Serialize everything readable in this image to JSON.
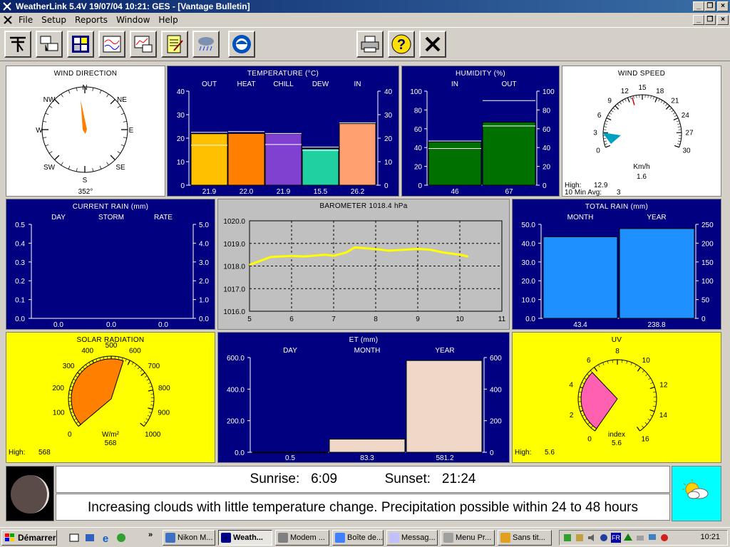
{
  "window": {
    "title": "WeatherLink 5.4V  19/07/04  10:21: GES - [Vantage Bulletin]"
  },
  "menu": [
    "File",
    "Setup",
    "Reports",
    "Window",
    "Help"
  ],
  "toolbar_icons": [
    "station-icon",
    "download-icon",
    "bulletin-icon",
    "strip-chart-icon",
    "graph-icon",
    "notes-icon",
    "rain-icon",
    "noaa-icon",
    "print-icon",
    "help-icon",
    "close-icon"
  ],
  "wind_direction": {
    "title": "WIND DIRECTION",
    "points": [
      "N",
      "NE",
      "E",
      "SE",
      "S",
      "SW",
      "W",
      "NW"
    ],
    "degrees": 352,
    "value": "352°"
  },
  "temperature": {
    "title": "TEMPERATURE (°C)",
    "ylim": [
      0,
      40
    ],
    "ticks": [
      "40",
      "30",
      "20",
      "10",
      "0"
    ],
    "bars": [
      {
        "label": "OUT",
        "value": 21.9,
        "hi": 22.5,
        "lo": 17.0,
        "color": "#ffc000",
        "text": "21.9"
      },
      {
        "label": "HEAT",
        "value": 22.0,
        "hi": 22.8,
        "lo": null,
        "color": "#ff8000",
        "text": "22.0"
      },
      {
        "label": "CHILL",
        "value": 21.9,
        "hi": 22.0,
        "lo": 17.3,
        "color": "#8040d0",
        "text": "21.9"
      },
      {
        "label": "DEW",
        "value": 15.5,
        "hi": 16.2,
        "lo": 14.8,
        "color": "#20d0a0",
        "text": "15.5"
      },
      {
        "label": "IN",
        "value": 26.2,
        "hi": 26.5,
        "lo": null,
        "color": "#ffa070",
        "text": "26.2"
      }
    ]
  },
  "humidity": {
    "title": "HUMIDITY (%)",
    "ticks": [
      "100",
      "80",
      "60",
      "40",
      "20",
      "0"
    ],
    "bars": [
      {
        "label": "IN",
        "value": 46,
        "hi": 47,
        "lo": 39,
        "text": "46"
      },
      {
        "label": "OUT",
        "value": 67,
        "hi": 90,
        "lo": 63,
        "text": "67"
      }
    ]
  },
  "wind_speed": {
    "title": "WIND SPEED",
    "ticks": [
      "0",
      "3",
      "6",
      "9",
      "12",
      "15",
      "18",
      "21",
      "24",
      "27",
      "30"
    ],
    "unit": "Km/h",
    "value": 1.6,
    "value_text": "1.6",
    "high_label": "High:",
    "high": "12.9",
    "avg_label": "10 Min Avg:",
    "avg": "3"
  },
  "current_rain": {
    "title": "CURRENT RAIN (mm)",
    "cols": [
      "DAY",
      "STORM",
      "RATE"
    ],
    "left_ticks": [
      "0.5",
      "0.4",
      "0.3",
      "0.2",
      "0.1",
      "0.0"
    ],
    "right_ticks": [
      "5.0",
      "4.0",
      "3.0",
      "2.0",
      "1.0",
      "0.0"
    ],
    "values": [
      "0.0",
      "0.0",
      "0.0"
    ]
  },
  "barometer": {
    "title": "BAROMETER 1018.4 hPa"
  },
  "total_rain": {
    "title": "TOTAL RAIN (mm)",
    "cols": [
      "MONTH",
      "YEAR"
    ],
    "left_ticks": [
      "50.0",
      "40.0",
      "30.0",
      "20.0",
      "10.0",
      "0.0"
    ],
    "right_ticks": [
      "250",
      "200",
      "150",
      "100",
      "50",
      "0"
    ],
    "values": [
      "43.4",
      "238.8"
    ]
  },
  "solar": {
    "title": "SOLAR RADIATION",
    "ticks": [
      "0",
      "100",
      "200",
      "300",
      "400",
      "500",
      "600",
      "700",
      "800",
      "900",
      "1000"
    ],
    "unit": "W/m²",
    "value": 568,
    "value_text": "568",
    "high_label": "High:",
    "high": "568"
  },
  "et": {
    "title": "ET (mm)",
    "cols": [
      "DAY",
      "MONTH",
      "YEAR"
    ],
    "left_ticks": [
      "600.0",
      "400.0",
      "200.0",
      "0.0"
    ],
    "right_ticks": [
      "600",
      "400",
      "200",
      "0"
    ],
    "values": [
      "0.5",
      "83.3",
      "581.2"
    ]
  },
  "uv": {
    "title": "UV",
    "ticks": [
      "0",
      "2",
      "4",
      "6",
      "8",
      "10",
      "12",
      "14",
      "16"
    ],
    "unit": "index",
    "value": 5.6,
    "value_text": "5.6",
    "high_label": "High:",
    "high": "5.6"
  },
  "sun": {
    "sunrise_label": "Sunrise:",
    "sunrise": "6:09",
    "sunset_label": "Sunset:",
    "sunset": "21:24"
  },
  "forecast": {
    "text": "Increasing clouds with little temperature change.  Precipitation possible within 24 to 48 hours"
  },
  "taskbar": {
    "start": "Démarrer",
    "tasks": [
      "Nikon M...",
      "Weath...",
      "Modem ...",
      "Boîte de...",
      "Messag...",
      "Menu Pr...",
      "Sans tit..."
    ],
    "clock": "10:21",
    "chevron": "»",
    "tray_lang": "FR"
  },
  "chart_data": [
    {
      "type": "line",
      "title": "BAROMETER 1018.4 hPa",
      "x": [
        5,
        5.5,
        6,
        6.3,
        6.8,
        7,
        7.3,
        7.5,
        7.8,
        8,
        8.3,
        8.7,
        9,
        9.3,
        9.6,
        10,
        10.2
      ],
      "y": [
        1018.05,
        1018.4,
        1018.45,
        1018.42,
        1018.5,
        1018.45,
        1018.6,
        1018.82,
        1018.78,
        1018.75,
        1018.68,
        1018.72,
        1018.76,
        1018.72,
        1018.6,
        1018.5,
        1018.42
      ],
      "xlim": [
        5,
        11
      ],
      "ylim": [
        1016.0,
        1020.0
      ],
      "xticks": [
        "5",
        "6",
        "7",
        "8",
        "9",
        "10",
        "11"
      ],
      "yticks": [
        "1020.0",
        "1019.0",
        "1018.0",
        "1017.0",
        "1016.0"
      ],
      "grid": true
    }
  ]
}
